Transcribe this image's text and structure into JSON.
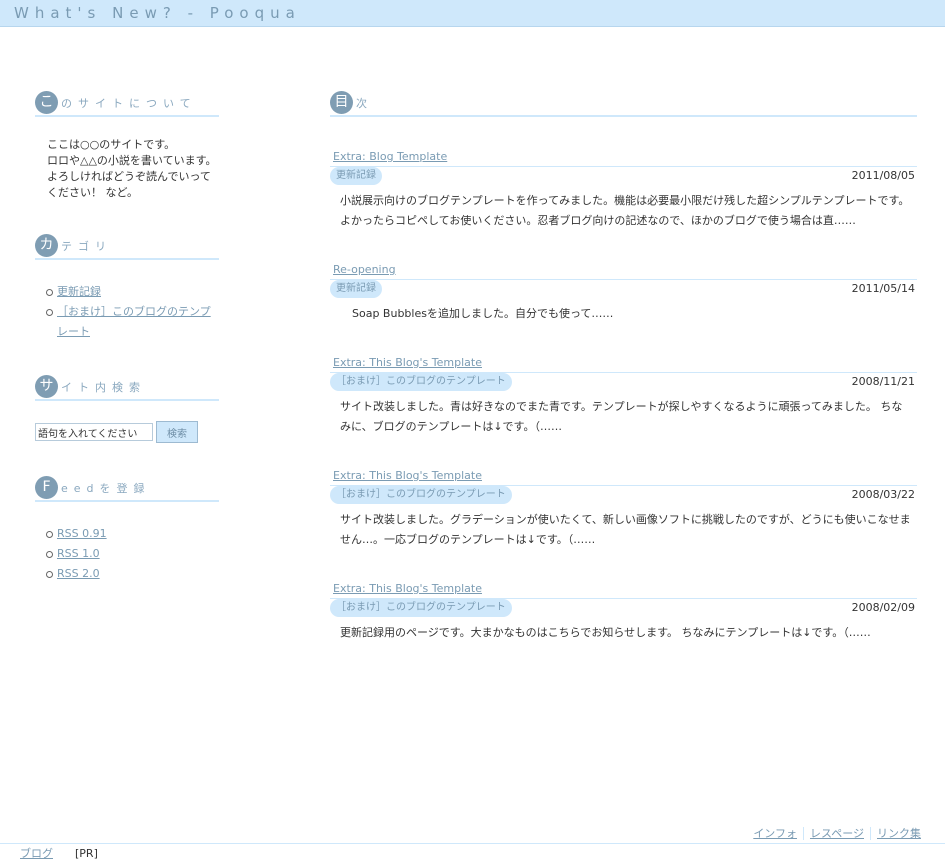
{
  "site": {
    "title": "What's New? - Pooqua"
  },
  "sidebar": {
    "about": {
      "cap": "こ",
      "title": "のサイトについて",
      "lines": [
        "ここは○○のサイトです。",
        "ロロや△△の小説を書いています。",
        "よろしければどうぞ読んでいってください！ など。"
      ]
    },
    "category": {
      "cap": "カ",
      "title": "テゴリ",
      "items": [
        "更新記録",
        "［おまけ］このブログのテンプレート"
      ]
    },
    "search": {
      "cap": "サ",
      "title": "イト内検索",
      "placeholder": "語句を入れてください",
      "button": "検索"
    },
    "feed": {
      "cap": "F",
      "title": "eedを登録",
      "items": [
        "RSS 0.91",
        "RSS 1.0",
        "RSS 2.0"
      ]
    }
  },
  "main": {
    "cap": "目",
    "title": "次",
    "entries": [
      {
        "title": "Extra: Blog Template",
        "category": "更新記録",
        "date": "2011/08/05",
        "excerpt": "小説展示向けのブログテンプレートを作ってみました。機能は必要最小限だけ残した超シンプルテンプレートです。よかったらコピペしてお使いください。忍者ブログ向けの記述なので、ほかのブログで使う場合は直……"
      },
      {
        "title": "Re-opening",
        "category": "更新記録",
        "date": "2011/05/14",
        "excerpt": "Soap Bubblesを追加しました。自分でも使って……"
      },
      {
        "title": "Extra: This Blog's Template",
        "category": "［おまけ］このブログのテンプレート",
        "date": "2008/11/21",
        "excerpt": "サイト改装しました。青は好きなのでまた青です。テンプレートが探しやすくなるように頑張ってみました。 ちなみに、ブログのテンプレートは↓です。（……"
      },
      {
        "title": "Extra: This Blog's Template",
        "category": "［おまけ］このブログのテンプレート",
        "date": "2008/03/22",
        "excerpt": "サイト改装しました。グラデーションが使いたくて、新しい画像ソフトに挑戦したのですが、どうにも使いこなせません…。一応ブログのテンプレートは↓です。（……"
      },
      {
        "title": "Extra: This Blog's Template",
        "category": "［おまけ］このブログのテンプレート",
        "date": "2008/02/09",
        "excerpt": "更新記録用のページです。大まかなものはこちらでお知らせします。 ちなみにテンプレートは↓です。（……"
      }
    ]
  },
  "footer": {
    "links": [
      "インフォ",
      "レスページ",
      "リンク集"
    ],
    "blog_link": "ブログ",
    "pr": "[PR]"
  },
  "colors": {
    "accent": "#cfe8fb",
    "cap": "#7f9db3",
    "link": "#7a9bb3"
  }
}
